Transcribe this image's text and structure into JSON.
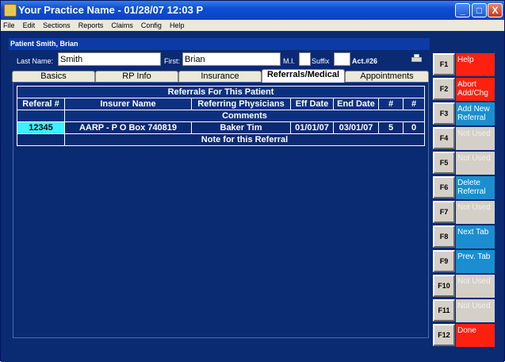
{
  "window": {
    "title": "Your Practice Name  - 01/28/07 12:03 P",
    "min_label": "_",
    "max_label": "□",
    "close_label": "X"
  },
  "menu": [
    "File",
    "Edit",
    "Sections",
    "Reports",
    "Claims",
    "Config",
    "Help"
  ],
  "patient": {
    "header": "Patient Smith, Brian",
    "last_name_label": "Last Name:",
    "last_name": "Smith",
    "first_label": "First:",
    "first_name": "Brian",
    "mi_label": "M.I.",
    "mi": "",
    "suffix_label": "Suffix",
    "suffix": "",
    "account": "Act.#26"
  },
  "tabs": [
    "Basics",
    "RP Info",
    "Insurance",
    "Referrals/Medical",
    "Appointments"
  ],
  "referrals": {
    "title": "Referrals For This Patient",
    "headers": [
      "Referal #",
      "Insurer Name",
      "Referring Physicians",
      "Eff Date",
      "End Date",
      "#",
      "#"
    ],
    "comments_label": "Comments",
    "rows": [
      {
        "referral": "12345",
        "insurer": "AARP - P O Box 740819",
        "physician": "Baker Tim",
        "eff": "01/01/07",
        "end": "03/01/07",
        "n1": "5",
        "n2": "0",
        "note": "Note for this Referral"
      }
    ]
  },
  "fkeys": [
    {
      "key": "F1",
      "label": "Help",
      "style": "red"
    },
    {
      "key": "F2",
      "label": "Abort Add/Chg",
      "style": "red"
    },
    {
      "key": "F3",
      "label": "Add New Referral",
      "style": "blue"
    },
    {
      "key": "F4",
      "label": "Not Used",
      "style": "gray"
    },
    {
      "key": "F5",
      "label": "Not Used",
      "style": "gray"
    },
    {
      "key": "F6",
      "label": "Delete Referral",
      "style": "blue"
    },
    {
      "key": "F7",
      "label": "Not Used",
      "style": "gray"
    },
    {
      "key": "F8",
      "label": "Next Tab",
      "style": "blue"
    },
    {
      "key": "F9",
      "label": "Prev. Tab",
      "style": "blue"
    },
    {
      "key": "F10",
      "label": "Not Used",
      "style": "gray"
    },
    {
      "key": "F11",
      "label": "Not Used",
      "style": "gray"
    },
    {
      "key": "F12",
      "label": "Done",
      "style": "red"
    }
  ],
  "colors": {
    "red": "#ff2010",
    "blue": "#1a8ed0",
    "gray": "#d4d0c8",
    "selected": "#3cf0ff"
  }
}
